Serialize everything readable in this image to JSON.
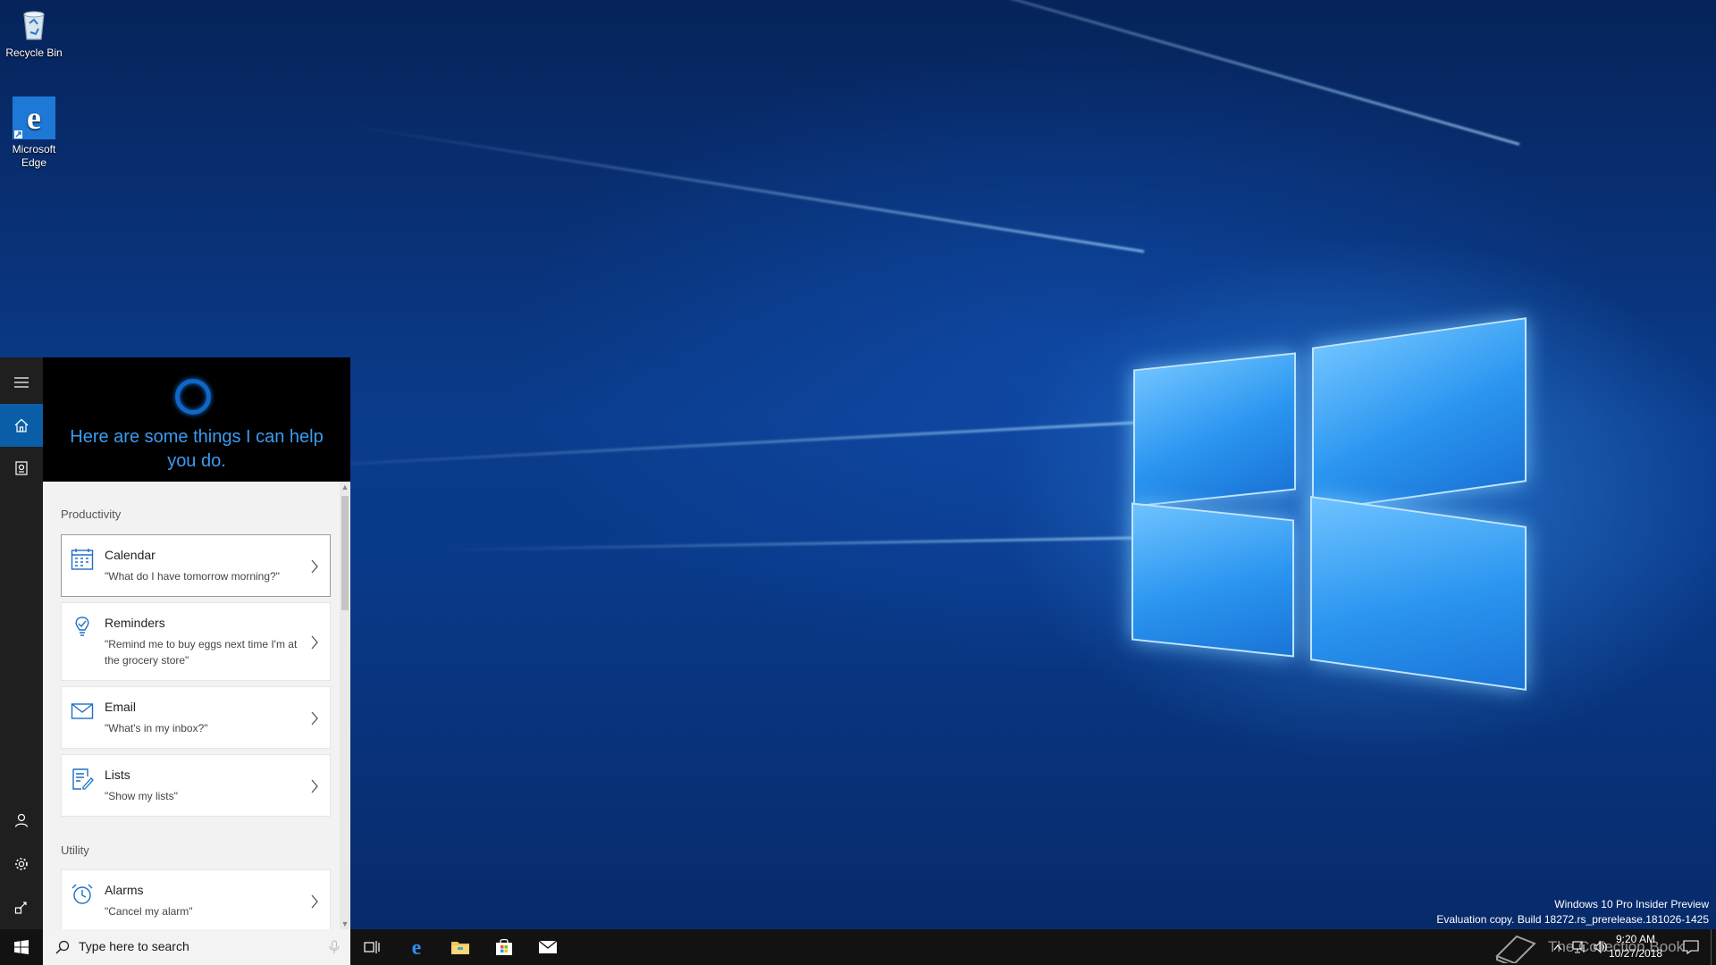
{
  "desktop": {
    "icons": [
      {
        "label": "Recycle Bin"
      },
      {
        "label": "Microsoft Edge"
      }
    ],
    "watermark": {
      "line1": "Windows 10 Pro Insider Preview",
      "line2": "Evaluation copy. Build 18272.rs_prerelease.181026-1425"
    },
    "logo_brand": "The Collection Book"
  },
  "cortana": {
    "headline": "Here are some things I can help you do.",
    "sections": [
      {
        "title": "Productivity",
        "cards": [
          {
            "title": "Calendar",
            "subtitle": "\"What do I have tomorrow morning?\"",
            "icon": "calendar-icon"
          },
          {
            "title": "Reminders",
            "subtitle": "\"Remind me to buy eggs next time I'm at the grocery store\"",
            "icon": "reminder-icon"
          },
          {
            "title": "Email",
            "subtitle": "\"What's in my inbox?\"",
            "icon": "mail-icon"
          },
          {
            "title": "Lists",
            "subtitle": "\"Show my lists\"",
            "icon": "list-icon"
          }
        ]
      },
      {
        "title": "Utility",
        "cards": [
          {
            "title": "Alarms",
            "subtitle": "\"Cancel my alarm\"",
            "icon": "alarm-icon"
          }
        ]
      }
    ],
    "rail_icons": [
      "hamburger-icon",
      "home-icon",
      "notebook-icon",
      "account-icon",
      "settings-icon",
      "feedback-icon"
    ]
  },
  "taskbar": {
    "search_placeholder": "Type here to search",
    "time": "9:20 AM",
    "date": "10/27/2018",
    "pinned": [
      "task-view-icon",
      "edge-icon",
      "file-explorer-icon",
      "store-icon",
      "mail-icon"
    ]
  },
  "colors": {
    "accent": "#0a5ea8",
    "cortana_blue": "#3a9cf0",
    "taskbar": "#121212"
  }
}
